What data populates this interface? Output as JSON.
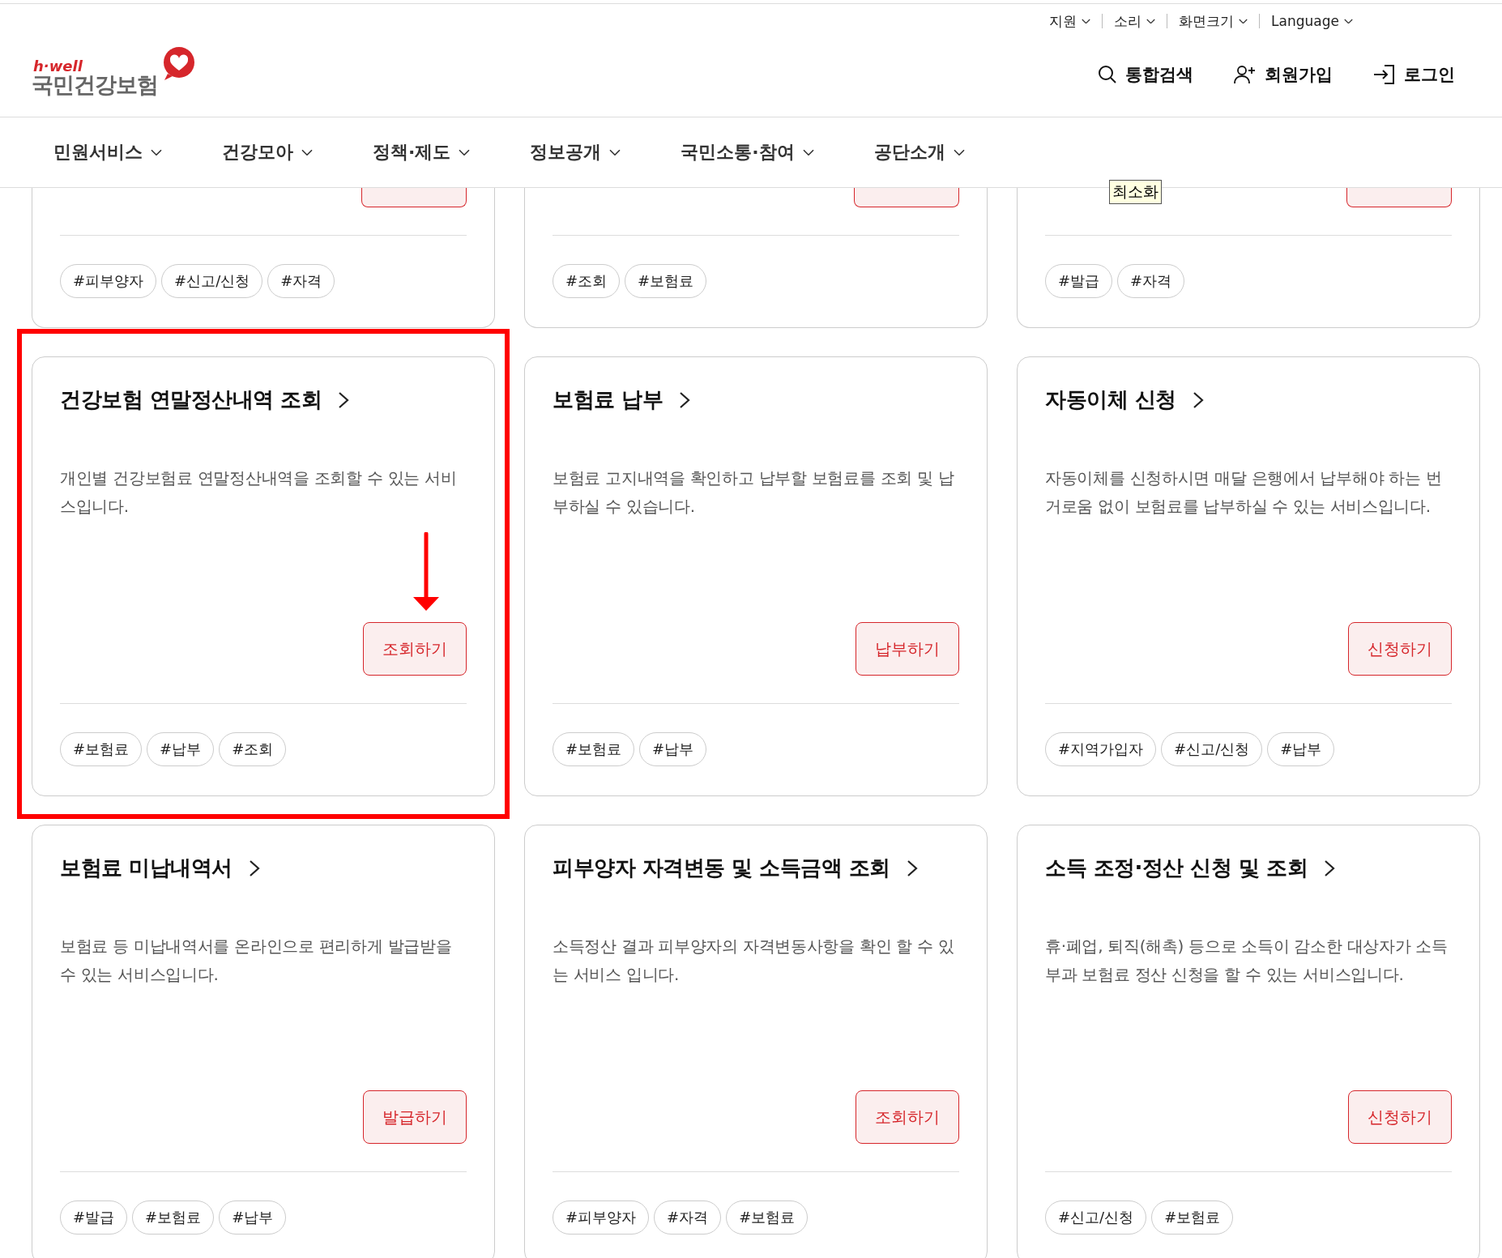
{
  "utility_menu": [
    {
      "label": "지원"
    },
    {
      "label": "소리"
    },
    {
      "label": "화면크기"
    },
    {
      "label": "Language"
    }
  ],
  "logo": {
    "tagline": "h·well",
    "name": "국민건강보험"
  },
  "header_actions": [
    {
      "kind": "search",
      "label": "통합검색"
    },
    {
      "kind": "join",
      "label": "회원가입"
    },
    {
      "kind": "login",
      "label": "로그인"
    }
  ],
  "nav": [
    {
      "label": "민원서비스"
    },
    {
      "label": "건강모아"
    },
    {
      "label": "정책·제도"
    },
    {
      "label": "정보공개"
    },
    {
      "label": "국민소통·참여"
    },
    {
      "label": "공단소개"
    }
  ],
  "tooltip": "최소화",
  "partial_cards": [
    {
      "tags": [
        "#피부양자",
        "#신고/신청",
        "#자격"
      ]
    },
    {
      "tags": [
        "#조회",
        "#보험료"
      ]
    },
    {
      "tags": [
        "#발급",
        "#자격"
      ]
    }
  ],
  "cards": [
    {
      "title": "건강보험 연말정산내역 조회",
      "description": "개인별 건강보험료 연말정산내역을 조회할 수 있는 서비스입니다.",
      "button": "조회하기",
      "tags": [
        "#보험료",
        "#납부",
        "#조회"
      ],
      "highlighted": true
    },
    {
      "title": "보험료 납부",
      "description": "보험료 고지내역을 확인하고 납부할 보험료를 조회 및 납부하실 수 있습니다.",
      "button": "납부하기",
      "tags": [
        "#보험료",
        "#납부"
      ],
      "highlighted": false
    },
    {
      "title": "자동이체 신청",
      "description": "자동이체를 신청하시면 매달 은행에서 납부해야 하는 번거로움 없이 보험료를 납부하실 수 있는 서비스입니다.",
      "button": "신청하기",
      "tags": [
        "#지역가입자",
        "#신고/신청",
        "#납부"
      ],
      "highlighted": false
    },
    {
      "title": "보험료 미납내역서",
      "description": "보험료 등 미납내역서를 온라인으로 편리하게 발급받을 수 있는 서비스입니다.",
      "button": "발급하기",
      "tags": [
        "#발급",
        "#보험료",
        "#납부"
      ],
      "highlighted": false
    },
    {
      "title": "피부양자 자격변동 및 소득금액 조회",
      "description": "소득정산 결과 피부양자의 자격변동사항을 확인 할 수 있는 서비스 입니다.",
      "button": "조회하기",
      "tags": [
        "#피부양자",
        "#자격",
        "#보험료"
      ],
      "highlighted": false
    },
    {
      "title": "소득 조정·정산 신청 및 조회",
      "description": "휴·폐업, 퇴직(해촉) 등으로 소득이 감소한 대상자가 소득 부과 보험료 정산 신청을 할 수 있는 서비스입니다.",
      "button": "신청하기",
      "tags": [
        "#신고/신청",
        "#보험료"
      ],
      "highlighted": false
    }
  ]
}
